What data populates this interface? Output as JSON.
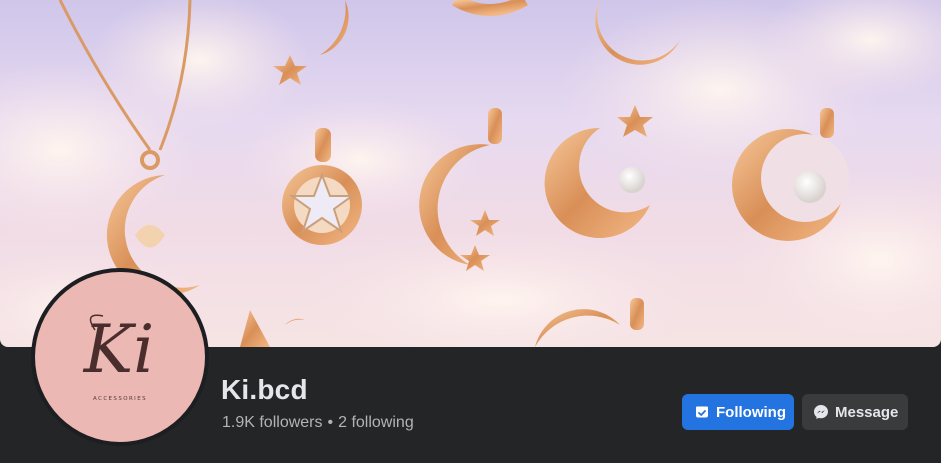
{
  "page": {
    "name": "Ki.bcd",
    "followers": "1.9K followers",
    "separator": "•",
    "following": "2 following"
  },
  "avatar": {
    "logo_text": "Ki",
    "logo_subtext": "ACCESSORIES"
  },
  "actions": {
    "following_label": "Following",
    "following_icon": "checked-page-icon",
    "message_label": "Message",
    "message_icon": "messenger-icon"
  },
  "colors": {
    "background": "#242526",
    "primary_button": "#2374e1",
    "secondary_button": "#3a3b3c",
    "name_text": "#e4e6eb",
    "secondary_text": "#b0b3b8",
    "avatar_bg": "#ebb8b3"
  }
}
